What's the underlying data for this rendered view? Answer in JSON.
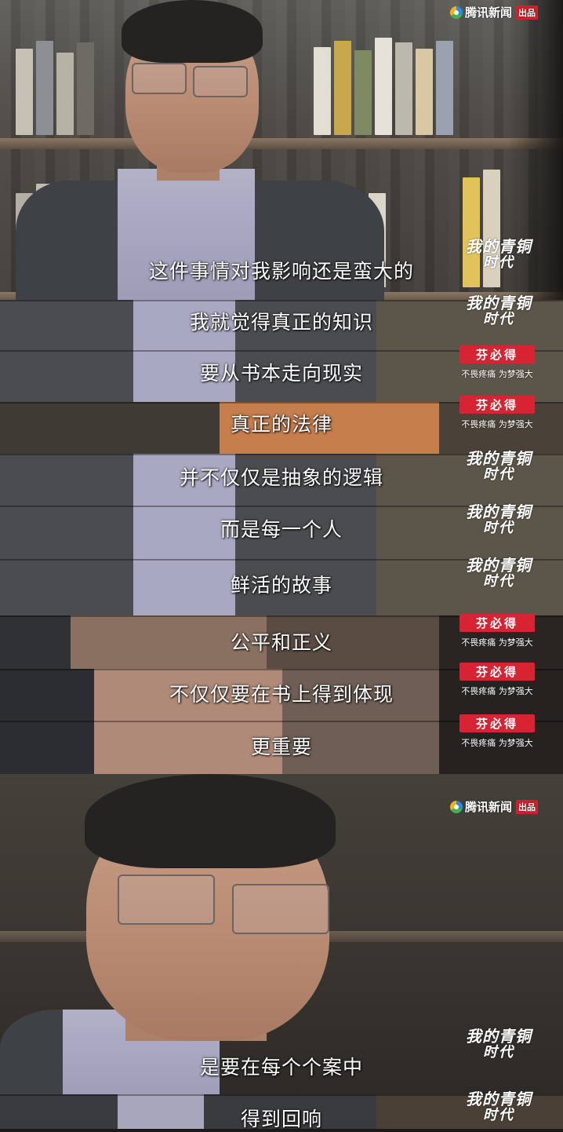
{
  "branding": {
    "news_logo_text": "腾讯新闻",
    "news_badge": "出品",
    "show_title_line1": "我的青铜",
    "show_title_line2": "时代",
    "ad_brand": "芬必得",
    "ad_slogan": "不畏疼痛 为梦强大",
    "colors": {
      "ad_red": "#d82432",
      "news_red": "#d51f2b",
      "subtitle": "#ffffff"
    }
  },
  "subtitles": [
    "这件事情对我影响还是蛮大的",
    "我就觉得真正的知识",
    "要从书本走向现实",
    "真正的法律",
    "并不仅仅是抽象的逻辑",
    "而是每一个人",
    "鲜活的故事",
    "公平和正义",
    "不仅仅要在书上得到体现",
    "更重要",
    "是要在每个个案中",
    "得到回响"
  ]
}
